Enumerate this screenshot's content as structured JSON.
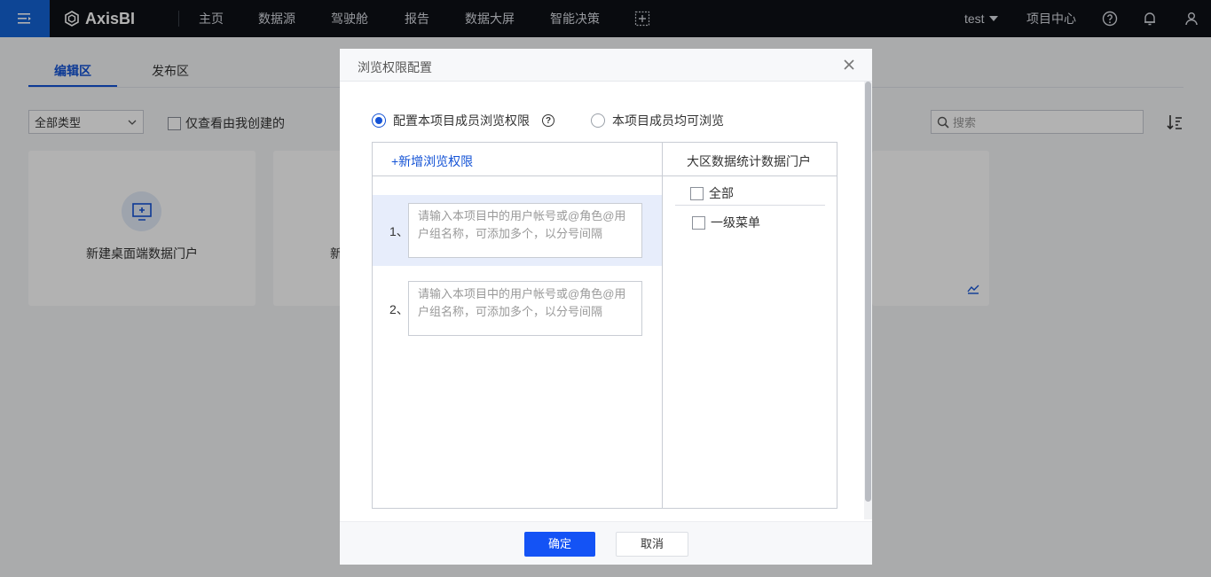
{
  "topbar": {
    "brand": "AxisBI",
    "nav": [
      "主页",
      "数据源",
      "驾驶舱",
      "报告",
      "数据大屏",
      "智能决策"
    ],
    "user": "test",
    "project_center": "项目中心",
    "icons": [
      "hamburger-icon",
      "axisbi-logo-icon",
      "add-screen-icon",
      "help-icon",
      "bell-icon",
      "user-icon"
    ]
  },
  "background": {
    "tabs": [
      "编辑区",
      "发布区"
    ],
    "type_select": "全部类型",
    "mine_filter": "仅查看由我创建的",
    "search_placeholder": "搜索",
    "card1_label": "新建桌面端数据门户",
    "card2_partial": "新"
  },
  "modal": {
    "title": "浏览权限配置",
    "radio_members": "配置本项目成员浏览权限",
    "radio_all": "本项目成员均可浏览",
    "add_link": "+新增浏览权限",
    "rows": [
      {
        "num": "1、",
        "placeholder": "请输入本项目中的用户帐号或@角色@用户组名称，可添加多个，以分号间隔"
      },
      {
        "num": "2、",
        "placeholder": "请输入本项目中的用户帐号或@角色@用户组名称，可添加多个，以分号间隔"
      }
    ],
    "portal_title": "大区数据统计数据门户",
    "menu_all": "全部",
    "menu_level1": "一级菜单",
    "ok": "确定",
    "cancel": "取消"
  },
  "colors": {
    "accent": "#1453d6",
    "topbar_bg": "#0d1016",
    "menu_btn": "#1463d6"
  }
}
